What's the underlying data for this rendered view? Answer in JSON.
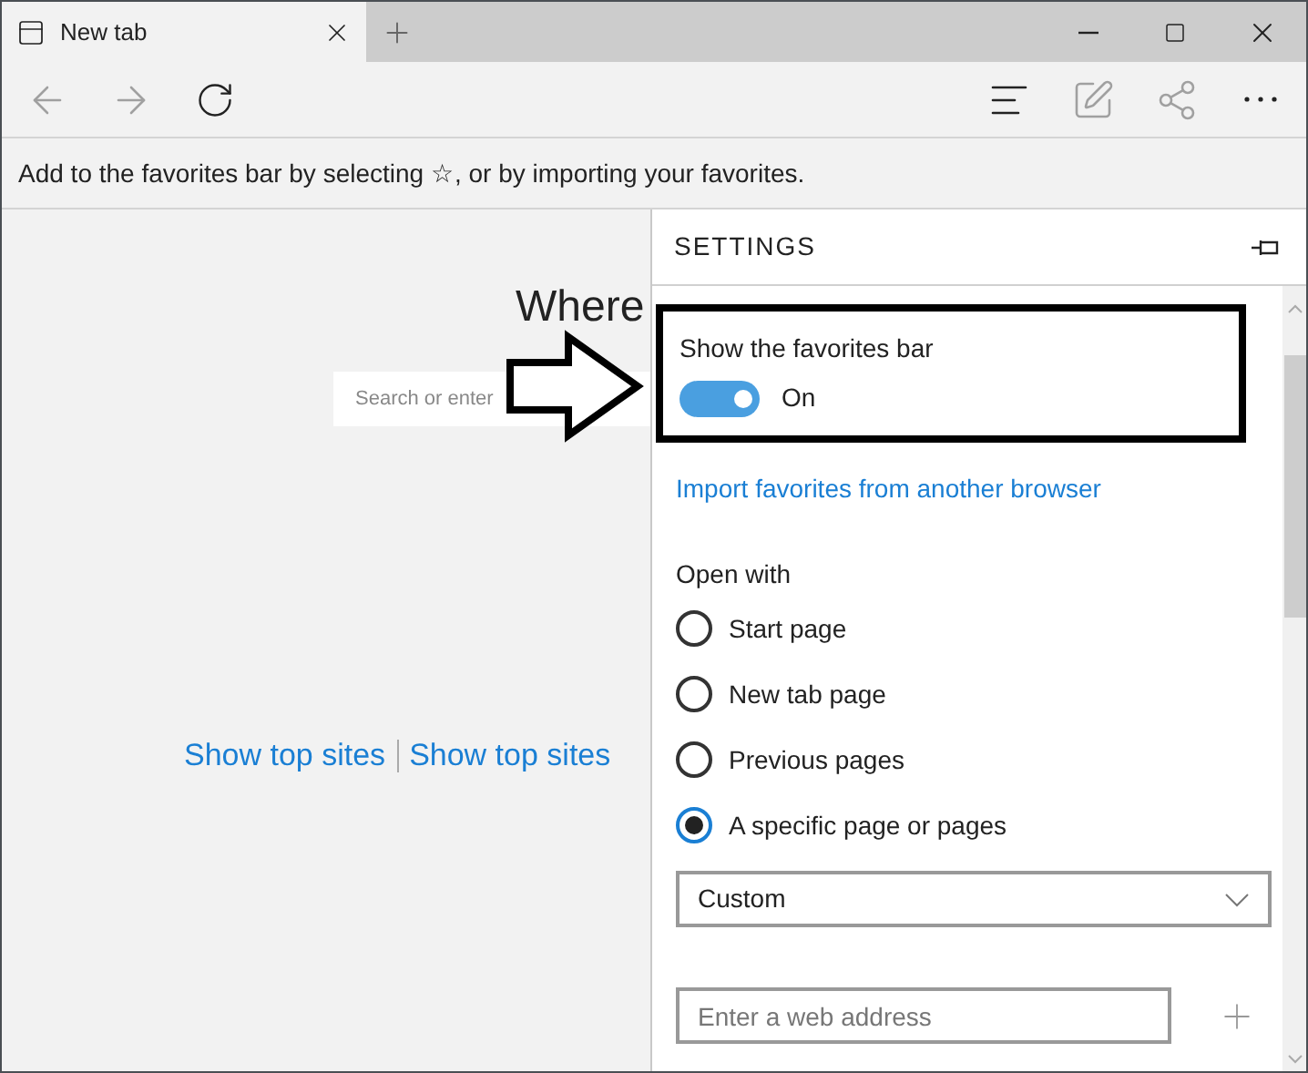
{
  "window": {
    "tab": {
      "title": "New tab"
    }
  },
  "toolbar": [
    {
      "kind": "back",
      "disabled": true
    },
    {
      "kind": "forward",
      "disabled": true
    },
    {
      "kind": "refresh",
      "disabled": false
    },
    {
      "kind": "hub",
      "disabled": false
    },
    {
      "kind": "note",
      "disabled": true
    },
    {
      "kind": "share",
      "disabled": true
    },
    {
      "kind": "more",
      "disabled": false
    }
  ],
  "favorites_message": "Add to the favorites bar by selecting ☆, or by importing your favorites.",
  "new_tab_page": {
    "heading": "Where",
    "search": {
      "placeholder": "Search or enter"
    },
    "links": [
      "Show top sites",
      "Show top sites"
    ]
  },
  "settings": {
    "title": "SETTINGS",
    "favorites_bar": {
      "label": "Show the favorites bar",
      "on": true,
      "state_text": "On"
    },
    "import_link": "Import favorites from another browser",
    "open_with": {
      "label": "Open with",
      "options": [
        {
          "label": "Start page",
          "selected": false
        },
        {
          "label": "New tab page",
          "selected": false
        },
        {
          "label": "Previous pages",
          "selected": false
        },
        {
          "label": "A specific page or pages",
          "selected": true
        }
      ]
    },
    "dropdown": {
      "value": "Custom"
    },
    "address": {
      "placeholder": "Enter a web address"
    }
  }
}
